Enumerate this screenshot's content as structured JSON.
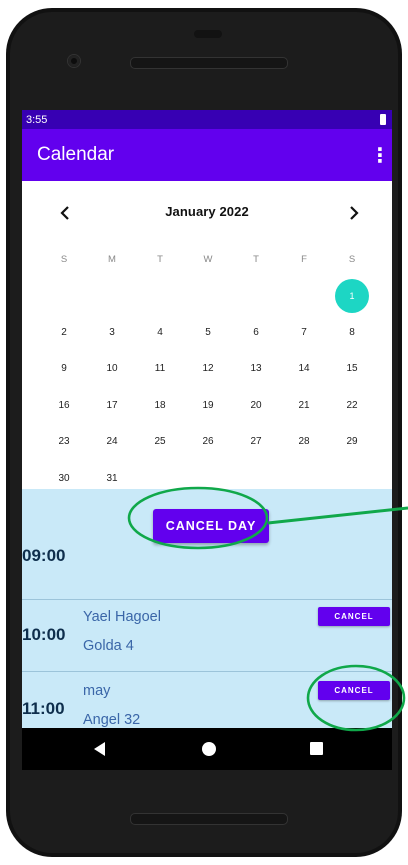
{
  "status_bar": {
    "time": "3:55",
    "battery_icon": "battery-icon"
  },
  "app_bar": {
    "title": "Calendar",
    "menu_icon": "more-vert-icon"
  },
  "calendar": {
    "month_label": "January 2022",
    "prev_icon": "chevron-left-icon",
    "next_icon": "chevron-right-icon",
    "weekdays": [
      "S",
      "M",
      "T",
      "W",
      "T",
      "F",
      "S"
    ],
    "weeks": [
      [
        "",
        "",
        "",
        "",
        "",
        "",
        "1"
      ],
      [
        "2",
        "3",
        "4",
        "5",
        "6",
        "7",
        "8"
      ],
      [
        "9",
        "10",
        "11",
        "12",
        "13",
        "14",
        "15"
      ],
      [
        "16",
        "17",
        "18",
        "19",
        "20",
        "21",
        "22"
      ],
      [
        "23",
        "24",
        "25",
        "26",
        "27",
        "28",
        "29"
      ],
      [
        "30",
        "31",
        "",
        "",
        "",
        "",
        ""
      ]
    ],
    "selected_day": "1",
    "selected_color": "#1DD6C4"
  },
  "schedule": {
    "cancel_day_label": "CANCEL DAY",
    "slots": [
      {
        "time": "09:00"
      },
      {
        "time": "10:00",
        "name": "Yael Hagoel",
        "address": "Golda 4",
        "cancel_label": "CANCEL"
      },
      {
        "time": "11:00",
        "name": "may",
        "address": "Angel 32",
        "cancel_label": "CANCEL"
      }
    ]
  },
  "colors": {
    "primary": "#6200EE",
    "primary_dark": "#3700B3",
    "schedule_bg": "#C9E9F8",
    "annotation": "#10A84A"
  },
  "nav_bar": {
    "back_icon": "back-triangle-icon",
    "home_icon": "home-circle-icon",
    "recent_icon": "recents-square-icon"
  }
}
